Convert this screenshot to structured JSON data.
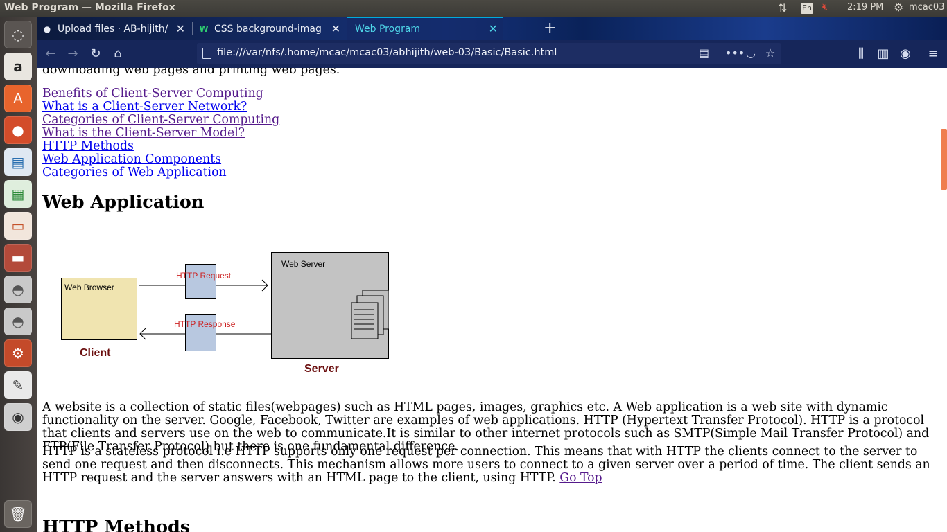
{
  "panel": {
    "window_title": "Web Program — Mozilla Firefox",
    "lang": "En",
    "time": "2:19 PM",
    "user": "mcac03"
  },
  "browser": {
    "tabs": [
      {
        "label": "Upload files · AB-hijith/W"
      },
      {
        "label": "CSS background-image p"
      },
      {
        "label": "Web Program"
      }
    ],
    "url": "file:///var/nfs/.home/mcac/mcac03/abhijith/web-03/Basic/Basic.html"
  },
  "page": {
    "cut_text": "downloading web pages and printing web pages.",
    "links": [
      "Benefits of Client-Server Computing",
      "What is a Client-Server Network?",
      "Categories of Client-Server Computing",
      "What is the Client-Server Model?",
      "HTTP Methods",
      "Web Application Components",
      "Categories of Web Application"
    ],
    "heading_web_app": "Web Application",
    "diagram": {
      "browser_label": "Web Browser",
      "server_label": "Web Server",
      "request_label": "HTTP Request",
      "response_label": "HTTP Response",
      "client_caption": "Client",
      "server_caption": "Server"
    },
    "para1": "A website is a collection of static files(webpages) such as HTML pages, images, graphics etc. A Web application is a web site with dynamic functionality on the server. Google, Facebook, Twitter are examples of web applications. HTTP (Hypertext Transfer Protocol). HTTP is a protocol that clients and servers use on the web to communicate.It is similar to other internet protocols such as SMTP(Simple Mail Transfer Protocol) and FTP(File Transfer Protocol) but there is one fundamental difference.",
    "para2": "HTTP is a stateless protocol i.e HTTP supports only one request per connection. This means that with HTTP the clients connect to the server to send one request and then disconnects. This mechanism allows more users to connect to a given server over a period of time. The client sends an HTTP request and the server answers with an HTML page to the client, using HTTP.",
    "go_top": "Go Top",
    "heading_http": "HTTP Methods"
  }
}
